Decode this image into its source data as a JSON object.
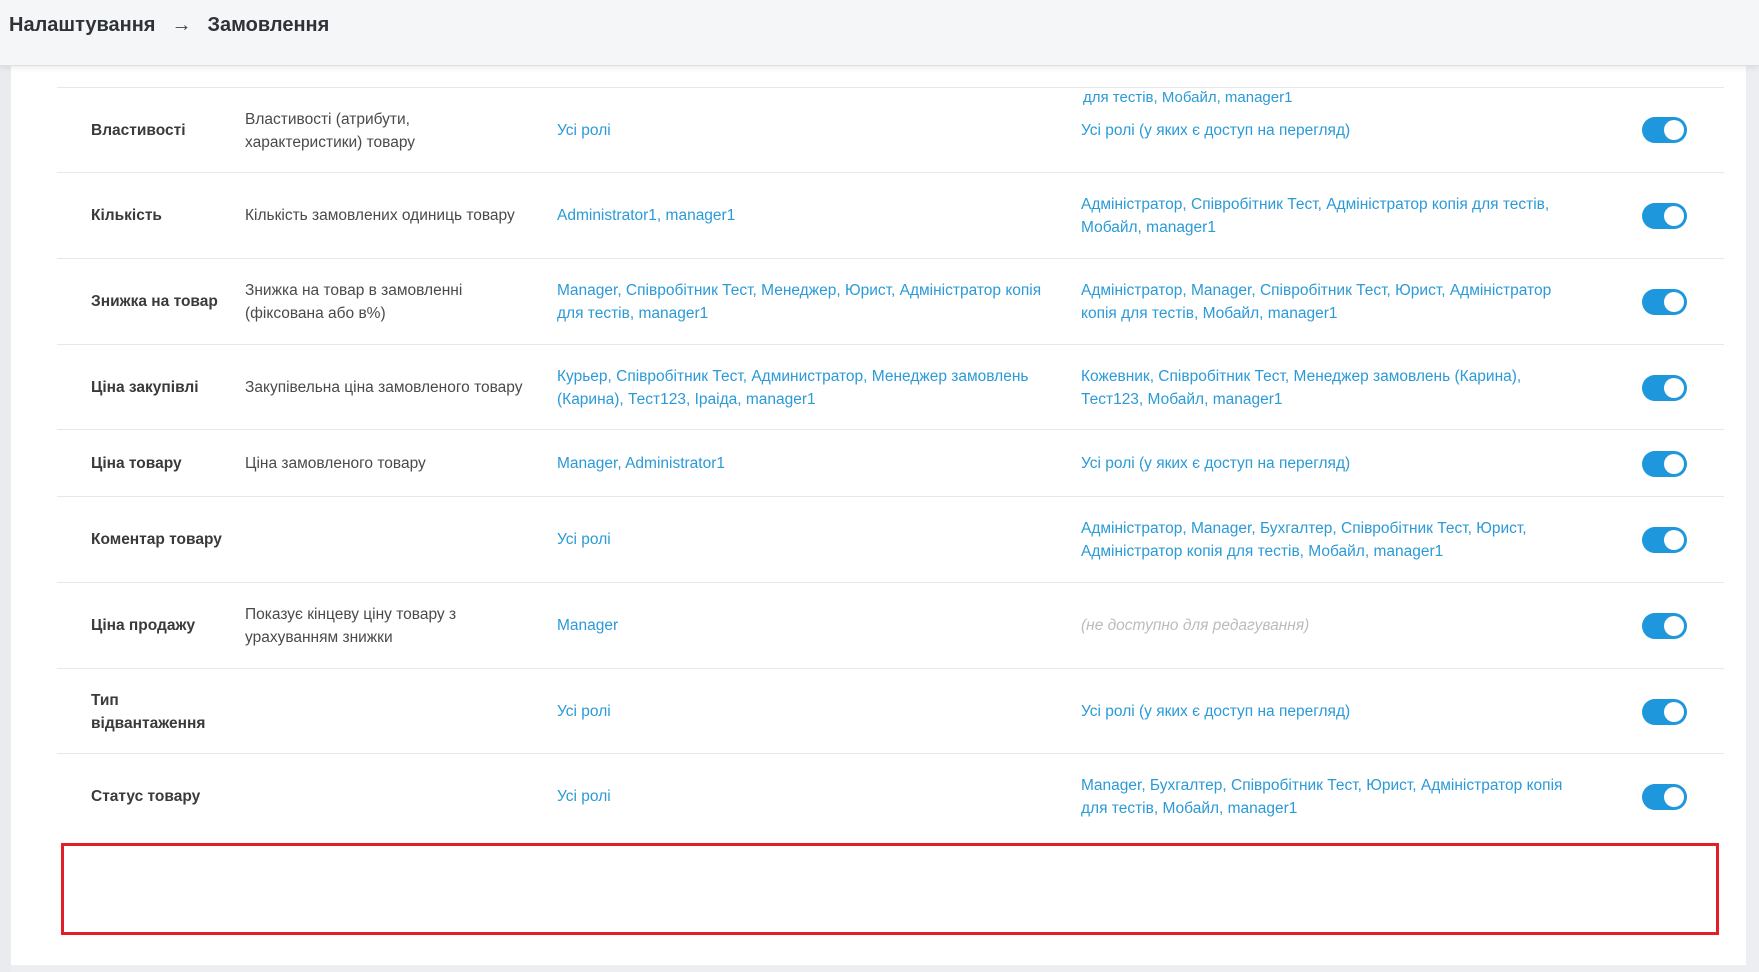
{
  "breadcrumb": {
    "parent": "Налаштування",
    "separator": "→",
    "current": "Замовлення"
  },
  "clipped_top_text": "для тестів, Мобайл, manager1",
  "rows": [
    {
      "name": "Властивості",
      "description": "Властивості (атрибути, характеристики) товару",
      "edit_roles": "Усі ролі",
      "view_roles": "Усі ролі (у яких є доступ на перегляд)",
      "enabled": true
    },
    {
      "name": "Кількість",
      "description": "Кількість замовлених одиниць товару",
      "edit_roles": "Administrator1, manager1",
      "view_roles": "Адміністратор, Співробітник Тест, Адміністратор копія для тестів, Мобайл, manager1",
      "enabled": true
    },
    {
      "name": "Знижка на товар",
      "description": "Знижка на товар в замовленні (фіксована або в%)",
      "edit_roles": "Manager, Співробітник Тест, Менеджер, Юрист, Адміністратор копія для тестів, manager1",
      "view_roles": "Адміністратор, Manager, Співробітник Тест, Юрист, Адміністратор копія для тестів, Мобайл, manager1",
      "enabled": true
    },
    {
      "name": "Ціна закупівлі",
      "description": "Закупівельна ціна замовленого товару",
      "edit_roles": "Курьер, Співробітник Тест, Администратор, Менеджер замовлень (Карина), Тест123, Іраіда, manager1",
      "view_roles": "Кожевник, Співробітник Тест, Менеджер замовлень (Карина), Тест123, Мобайл, manager1",
      "enabled": true
    },
    {
      "name": "Ціна товару",
      "description": "Ціна замовленого товару",
      "edit_roles": "Manager, Administrator1",
      "view_roles": "Усі ролі (у яких є доступ на перегляд)",
      "enabled": true
    },
    {
      "name": "Коментар товару",
      "description": "",
      "edit_roles": "Усі ролі",
      "view_roles": "Адміністратор, Manager, Бухгалтер, Співробітник Тест, Юрист, Адміністратор копія для тестів, Мобайл, manager1",
      "enabled": true
    },
    {
      "name": "Ціна продажу",
      "description": "Показує кінцеву ціну товару з урахуванням знижки",
      "edit_roles": "Manager",
      "view_roles": "(не доступно для редагування)",
      "enabled": true
    },
    {
      "name": "Тип відвантаження",
      "description": "",
      "edit_roles": "Усі ролі",
      "view_roles": "Усі ролі (у яких є доступ на перегляд)",
      "enabled": true
    },
    {
      "name": "Статус товару",
      "description": "",
      "edit_roles": "Усі ролі",
      "view_roles": "Manager, Бухгалтер, Співробітник Тест, Юрист, Адміністратор копія для тестів, Мобайл, manager1",
      "enabled": true
    }
  ],
  "colors": {
    "link": "#2b9ad6",
    "toggle_on": "#1e97dc",
    "highlight": "#e31e24"
  }
}
